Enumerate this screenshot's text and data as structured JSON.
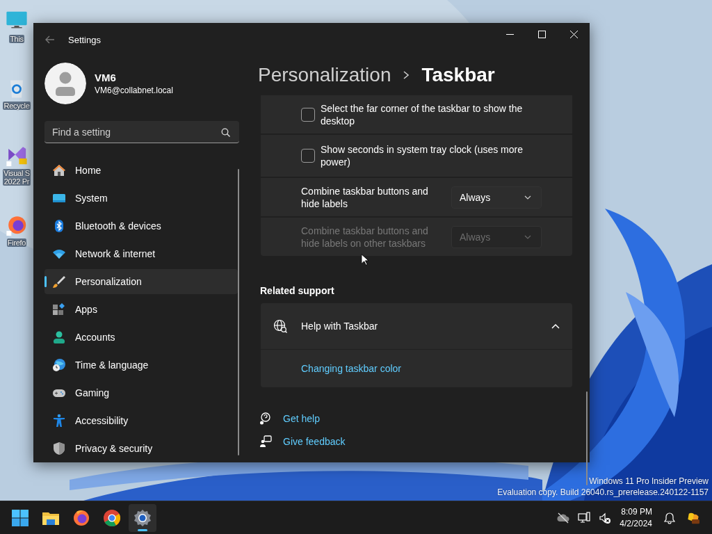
{
  "desktop": {
    "icons": [
      {
        "kind": "monitor",
        "label": "This"
      },
      {
        "kind": "recycle",
        "label": "Recycle"
      },
      {
        "kind": "studio",
        "label": "Visual S\n2022 Pr"
      },
      {
        "kind": "firefox",
        "label": "Firefo"
      }
    ],
    "watermark": [
      "Windows 11 Pro Insider Preview",
      "Evaluation copy. Build 26040.rs_prerelease.240122-1157"
    ]
  },
  "window": {
    "title": "Settings"
  },
  "account": {
    "name": "VM6",
    "email": "VM6@collabnet.local"
  },
  "search": {
    "placeholder": "Find a setting"
  },
  "sidebar": {
    "items": [
      {
        "kind": "home",
        "label": "Home",
        "selected": false
      },
      {
        "kind": "system",
        "label": "System",
        "selected": false
      },
      {
        "kind": "bluetooth",
        "label": "Bluetooth & devices",
        "selected": false
      },
      {
        "kind": "network",
        "label": "Network & internet",
        "selected": false
      },
      {
        "kind": "personalization",
        "label": "Personalization",
        "selected": true
      },
      {
        "kind": "apps",
        "label": "Apps",
        "selected": false
      },
      {
        "kind": "accounts",
        "label": "Accounts",
        "selected": false
      },
      {
        "kind": "time",
        "label": "Time & language",
        "selected": false
      },
      {
        "kind": "gaming",
        "label": "Gaming",
        "selected": false
      },
      {
        "kind": "accessibility",
        "label": "Accessibility",
        "selected": false
      },
      {
        "kind": "privacy",
        "label": "Privacy & security",
        "selected": false
      }
    ]
  },
  "header": {
    "breadcrumb": [
      "Personalization",
      "Taskbar"
    ]
  },
  "settings": [
    {
      "kind": "checkbox",
      "label": "Select the far corner of the taskbar to show the desktop",
      "checked": false
    },
    {
      "kind": "checkbox",
      "label": "Show seconds in system tray clock (uses more power)",
      "checked": false
    },
    {
      "kind": "dropdown",
      "label": "Combine taskbar buttons and hide labels",
      "value": "Always",
      "disabled": false
    },
    {
      "kind": "dropdown",
      "label": "Combine taskbar buttons and hide labels on other taskbars",
      "value": "Always",
      "disabled": true
    }
  ],
  "related_support": {
    "heading": "Related support",
    "title": "Help with Taskbar",
    "expanded": true,
    "links": [
      "Changing taskbar color"
    ]
  },
  "footer_links": [
    {
      "kind": "help",
      "label": "Get help"
    },
    {
      "kind": "feedback",
      "label": "Give feedback"
    }
  ],
  "taskbar": {
    "apps": [
      {
        "kind": "start",
        "selected": false
      },
      {
        "kind": "folder",
        "selected": false
      },
      {
        "kind": "firefox",
        "selected": false
      },
      {
        "kind": "chrome",
        "selected": false
      },
      {
        "kind": "settings",
        "selected": true
      }
    ],
    "clock": {
      "time": "8:09 PM",
      "date": "4/2/2024"
    }
  }
}
